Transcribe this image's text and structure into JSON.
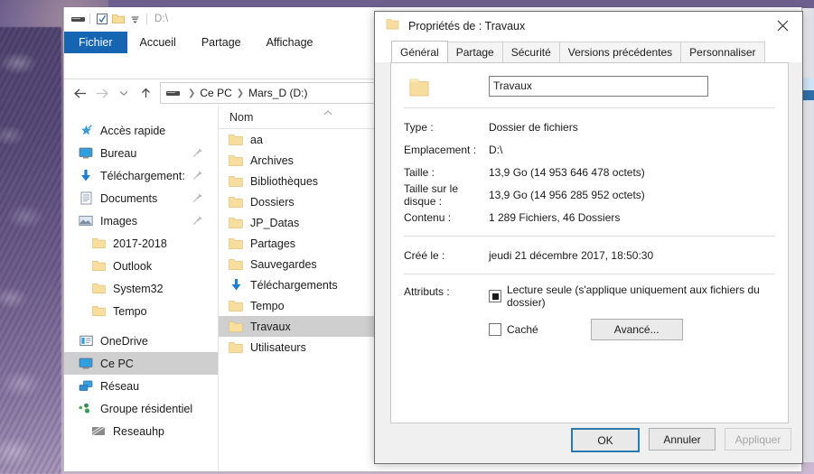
{
  "desktop": {
    "wallpaper_name": "snowy-pine-tree-purple-sky"
  },
  "explorer": {
    "quick_access_toolbar": {
      "drive_icon": "drive-icon",
      "properties_icon": "properties-checkbox-icon",
      "new_folder_icon": "new-folder-icon",
      "customize_icon": "chevron-down-icon",
      "path_label": "D:\\"
    },
    "ribbon_tabs": [
      {
        "label": "Fichier",
        "active": true
      },
      {
        "label": "Accueil",
        "active": false
      },
      {
        "label": "Partage",
        "active": false
      },
      {
        "label": "Affichage",
        "active": false
      }
    ],
    "nav": {
      "back_icon": "arrow-left-icon",
      "forward_icon": "arrow-right-icon",
      "recent_icon": "chevron-down-icon",
      "up_icon": "arrow-up-icon",
      "breadcrumb_drive_icon": "drive-icon",
      "breadcrumb": [
        "Ce PC",
        "Mars_D (D:)"
      ]
    },
    "sidebar": [
      {
        "label": "Accès rapide",
        "icon": "star-pin-icon",
        "indent": false,
        "pinned": false,
        "selected": false
      },
      {
        "label": "Bureau",
        "icon": "desktop-icon",
        "indent": false,
        "pinned": true,
        "selected": false
      },
      {
        "label": "Téléchargement:",
        "icon": "download-arrow-icon",
        "indent": false,
        "pinned": true,
        "selected": false
      },
      {
        "label": "Documents",
        "icon": "documents-icon",
        "indent": false,
        "pinned": true,
        "selected": false
      },
      {
        "label": "Images",
        "icon": "pictures-icon",
        "indent": false,
        "pinned": true,
        "selected": false
      },
      {
        "label": "2017-2018",
        "icon": "folder-icon",
        "indent": true,
        "pinned": false,
        "selected": false
      },
      {
        "label": "Outlook",
        "icon": "folder-icon",
        "indent": true,
        "pinned": false,
        "selected": false
      },
      {
        "label": "System32",
        "icon": "folder-icon",
        "indent": true,
        "pinned": false,
        "selected": false
      },
      {
        "label": "Tempo",
        "icon": "folder-icon",
        "indent": true,
        "pinned": false,
        "selected": false
      },
      {
        "label": "OneDrive",
        "icon": "onedrive-icon",
        "indent": false,
        "pinned": false,
        "selected": false
      },
      {
        "label": "Ce PC",
        "icon": "this-pc-icon",
        "indent": false,
        "pinned": false,
        "selected": true
      },
      {
        "label": "Réseau",
        "icon": "network-icon",
        "indent": false,
        "pinned": false,
        "selected": false
      },
      {
        "label": "Groupe résidentiel",
        "icon": "homegroup-icon",
        "indent": false,
        "pinned": false,
        "selected": false
      },
      {
        "label": "Reseauhp",
        "icon": "network-share-icon",
        "indent": true,
        "pinned": false,
        "selected": false
      }
    ],
    "list": {
      "column_header": "Nom",
      "sort_indicator": "chevron-up-icon",
      "items": [
        {
          "label": "aa",
          "icon": "folder-icon",
          "selected": false
        },
        {
          "label": "Archives",
          "icon": "folder-icon",
          "selected": false
        },
        {
          "label": "Bibliothèques",
          "icon": "folder-icon",
          "selected": false
        },
        {
          "label": "Dossiers",
          "icon": "folder-icon",
          "selected": false
        },
        {
          "label": "JP_Datas",
          "icon": "folder-icon",
          "selected": false
        },
        {
          "label": "Partages",
          "icon": "folder-icon",
          "selected": false
        },
        {
          "label": "Sauvegardes",
          "icon": "folder-icon",
          "selected": false
        },
        {
          "label": "Téléchargements",
          "icon": "download-folder-icon",
          "selected": false
        },
        {
          "label": "Tempo",
          "icon": "folder-icon",
          "selected": false
        },
        {
          "label": "Travaux",
          "icon": "folder-icon",
          "selected": true
        },
        {
          "label": "Utilisateurs",
          "icon": "folder-icon",
          "selected": false
        }
      ]
    }
  },
  "dialog": {
    "title": "Propriétés de : Travaux",
    "title_icon": "folder-icon",
    "close_icon": "close-icon",
    "tabs": [
      {
        "label": "Général",
        "active": true
      },
      {
        "label": "Partage",
        "active": false
      },
      {
        "label": "Sécurité",
        "active": false
      },
      {
        "label": "Versions précédentes",
        "active": false
      },
      {
        "label": "Personnaliser",
        "active": false
      }
    ],
    "folder_icon": "folder-large-icon",
    "name_value": "Travaux",
    "properties": [
      {
        "label": "Type :",
        "value": "Dossier de fichiers"
      },
      {
        "label": "Emplacement :",
        "value": "D:\\"
      },
      {
        "label": "Taille :",
        "value": "13,9 Go (14 953 646 478 octets)"
      },
      {
        "label": "Taille sur le disque :",
        "value": "13,9 Go (14 956 285 952 octets)"
      },
      {
        "label": "Contenu :",
        "value": "1 289 Fichiers, 46 Dossiers"
      }
    ],
    "created": {
      "label": "Créé le :",
      "value": "jeudi 21 décembre 2017, 18:50:30"
    },
    "attributes": {
      "label": "Attributs :",
      "readonly": {
        "label": "Lecture seule (s'applique uniquement aux fichiers du dossier)",
        "state": "indeterminate"
      },
      "hidden": {
        "label": "Caché",
        "state": "unchecked"
      },
      "advanced_button": "Avancé..."
    },
    "buttons": {
      "ok": "OK",
      "cancel": "Annuler",
      "apply": "Appliquer",
      "apply_disabled": true
    }
  },
  "colors": {
    "accent_blue": "#1665b3",
    "focus_blue": "#2a7ab0",
    "selection_gray": "#cfcfcf",
    "folder_yellow": "#f5d88a"
  }
}
